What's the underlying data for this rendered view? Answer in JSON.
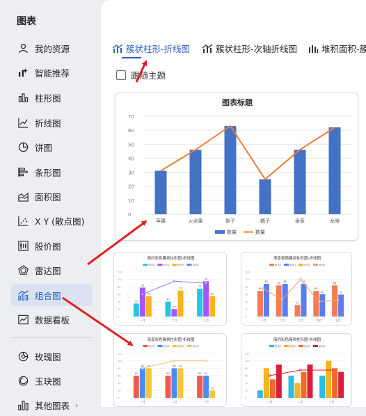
{
  "sidebar": {
    "title": "图表",
    "items": [
      {
        "label": "我的资源",
        "icon": "user-icon"
      },
      {
        "label": "智能推荐",
        "icon": "smart-recommend-icon"
      },
      {
        "label": "柱形图",
        "icon": "bar-chart-icon"
      },
      {
        "label": "折线图",
        "icon": "line-chart-icon"
      },
      {
        "label": "饼图",
        "icon": "pie-chart-icon"
      },
      {
        "label": "条形图",
        "icon": "horizontal-bar-icon"
      },
      {
        "label": "面积图",
        "icon": "area-chart-icon"
      },
      {
        "label": "X Y (散点图)",
        "icon": "scatter-chart-icon"
      },
      {
        "label": "股价图",
        "icon": "stock-chart-icon"
      },
      {
        "label": "雷达图",
        "icon": "radar-chart-icon"
      },
      {
        "label": "组合图",
        "icon": "combo-chart-icon"
      },
      {
        "label": "数据看板",
        "icon": "dashboard-icon"
      },
      {
        "label": "玫瑰图",
        "icon": "rose-chart-icon"
      },
      {
        "label": "玉玦图",
        "icon": "jade-ring-chart-icon"
      },
      {
        "label": "其他图表",
        "icon": "other-chart-icon"
      }
    ],
    "active_index": 10
  },
  "tabs": [
    {
      "label": "簇状柱形-折线图"
    },
    {
      "label": "簇状柱形-次轴折线图"
    },
    {
      "label": "堆积面积-簇"
    }
  ],
  "follow_theme_label": "跟随主题",
  "colors": {
    "accent": "#2b5cc5",
    "bar": "#4472c4",
    "line": "#ed7d31",
    "arrow": "#e0201e"
  },
  "chart_data": {
    "type": "bar",
    "title": "图表标题",
    "categories": [
      "苹果",
      "火龙果",
      "梨子",
      "橘子",
      "香蕉",
      "龙眼"
    ],
    "series": [
      {
        "name": "数量",
        "type": "bar",
        "values": [
          31,
          46,
          63,
          25,
          46,
          62
        ]
      },
      {
        "name": "数量",
        "type": "line",
        "values": [
          31,
          46,
          63,
          25,
          46,
          62
        ]
      }
    ],
    "ylim": [
      0,
      70
    ],
    "yticks": [
      0,
      10,
      20,
      30,
      40,
      50,
      60,
      70
    ],
    "grid": true,
    "legend": "bottom"
  },
  "templates": [
    {
      "title": "简约彩色簇状柱形图-折线图",
      "legend": [
        "系列1",
        "系列2",
        "系列3",
        "系列4"
      ],
      "categories": [
        "一月",
        "二月",
        "三月"
      ],
      "bars": [
        [
          35,
          40,
          75
        ],
        [
          78,
          20,
          95
        ],
        [
          55,
          70,
          55
        ]
      ],
      "line": [
        60,
        95,
        90
      ],
      "labels": [
        [
          35,
          40,
          75
        ],
        [
          78,
          20,
          95
        ],
        [
          55,
          70,
          55
        ]
      ]
    },
    {
      "title": "渐变极简簇状柱形图-折线图",
      "legend": [
        "系列1",
        "系列2",
        "系列3",
        "系列4"
      ],
      "categories": [
        "一月",
        "二月",
        "三月",
        "四月",
        "五月"
      ],
      "bars": [
        [
          69,
          84,
          31,
          69,
          84
        ],
        [
          88,
          88,
          88,
          60,
          59
        ]
      ],
      "line": [
        75,
        45,
        100,
        40,
        45
      ],
      "labels": [
        [
          69,
          84,
          31,
          69,
          84
        ],
        [
          88,
          88,
          88,
          60,
          59
        ]
      ]
    },
    {
      "title": "渐变彩色簇状柱形图-折线图",
      "legend": [
        "系列1",
        "系列2",
        "系列3",
        "系列4"
      ],
      "categories": [
        "一月",
        "二月",
        "三月"
      ],
      "bars": [
        [
          60,
          60,
          60
        ],
        [
          80,
          80,
          60
        ],
        [
          80,
          80,
          20
        ]
      ],
      "line": [
        80,
        100,
        100
      ],
      "labels": [
        [
          60,
          60,
          60
        ],
        [
          80,
          80,
          60
        ],
        [
          80,
          80,
          20
        ]
      ]
    },
    {
      "title": "简约彩色簇状柱形图-折线图",
      "legend": [
        "系列1",
        "系列2",
        "系列3",
        "系列4"
      ],
      "categories": [
        "一月",
        "二月",
        "三月"
      ],
      "bars": [
        [
          20,
          60,
          60
        ],
        [
          80,
          40,
          100
        ],
        [
          50,
          70,
          80
        ],
        [
          90,
          90,
          70
        ]
      ],
      "line": [
        60,
        75,
        75
      ],
      "labels": []
    }
  ]
}
